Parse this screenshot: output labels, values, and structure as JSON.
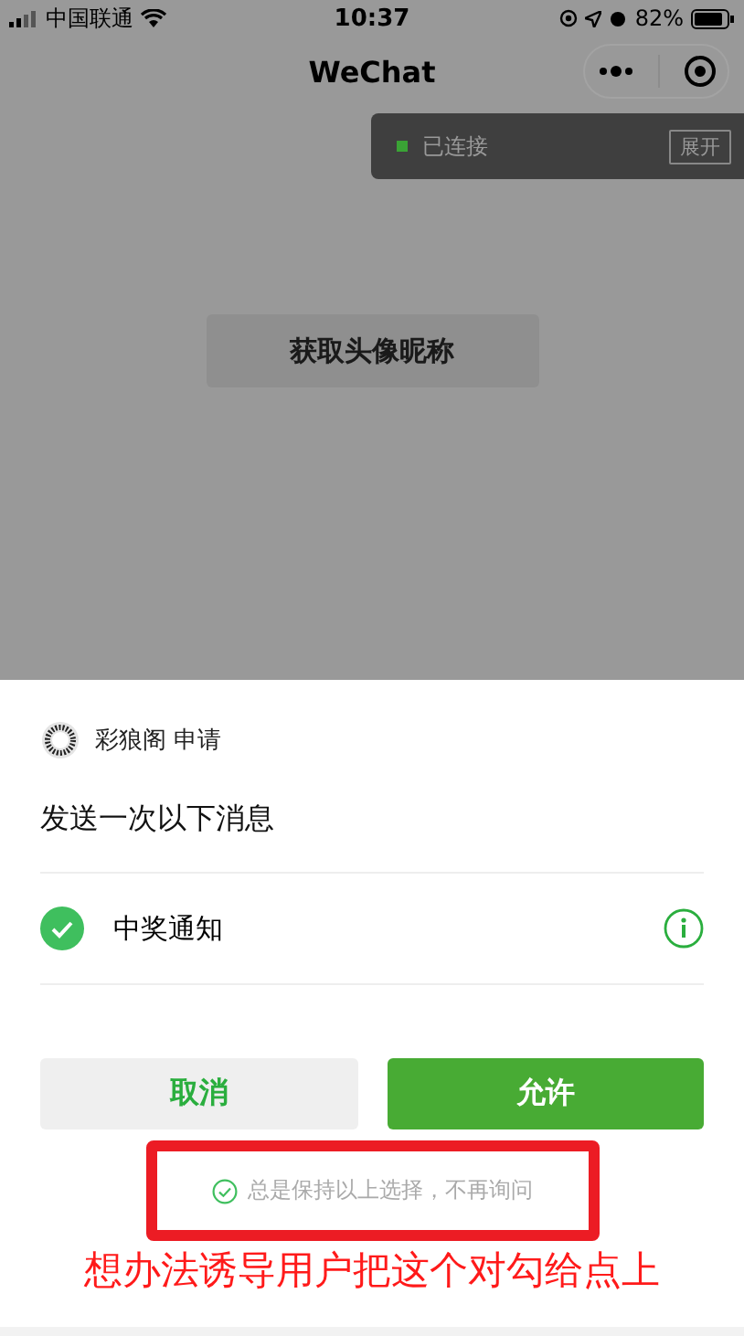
{
  "status_bar": {
    "carrier": "中国联通",
    "time": "10:37",
    "battery": "82%"
  },
  "nav": {
    "title": "WeChat"
  },
  "toast": {
    "text": "已连接",
    "connected": true,
    "button": "展开"
  },
  "main_button": {
    "label": "获取头像昵称"
  },
  "sheet": {
    "app_name": "彩狼阁 申请",
    "heading": "发送一次以下消息",
    "items": [
      {
        "label": "中奖通知",
        "checked": true
      }
    ],
    "buttons": [
      {
        "label": "取消",
        "kind": "secondary"
      },
      {
        "label": "允许",
        "kind": "primary"
      }
    ],
    "always": {
      "label": "总是保持以上选择，不再询问",
      "checked": false
    }
  },
  "annotation": {
    "text": "想办法诱导用户把这个对勾给点上"
  }
}
